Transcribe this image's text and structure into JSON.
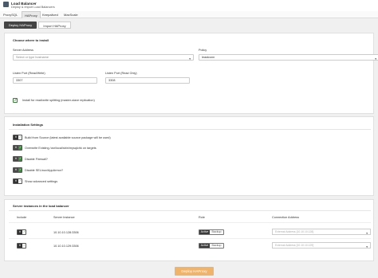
{
  "header": {
    "title": "Load Balancer",
    "subtitle": "Deploy & Import Load Balancers"
  },
  "tabs": [
    "ProxySQL",
    "HAProxy",
    "Keepalived",
    "MaxScale"
  ],
  "active_tab": "HAProxy",
  "subtabs": {
    "deploy": "Deploy HAProxy",
    "import": "Import HAProxy"
  },
  "install": {
    "section_title": "Choose where to install",
    "server_address_label": "Server Address",
    "server_address_placeholder": "Select or type hostname",
    "policy_label": "Policy",
    "policy_value": "leastconn",
    "listen_rw_label": "Listen Port (Read/Write)",
    "listen_rw_value": "3307",
    "listen_ro_label": "Listen Port (Read Only)",
    "listen_ro_value": "3308",
    "rw_split_label": "Install for read/write splitting (master-slave replication)"
  },
  "settings": {
    "section_title": "Installation Settings",
    "options": [
      {
        "label": "Build from Source (latest available source package will be used)",
        "state": "off"
      },
      {
        "label": "Overwrite Existing /usr/local/sbin/mysqlchk on targets",
        "state": "on"
      },
      {
        "label": "Disable Firewall?",
        "state": "on"
      },
      {
        "label": "Disable SELinux/AppArmor?",
        "state": "on"
      },
      {
        "label": "Show advanced settings",
        "state": "off"
      }
    ]
  },
  "instances": {
    "section_title": "Server instances in the load balancer",
    "columns": {
      "include": "Include",
      "server": "Server Instance",
      "role": "Role",
      "conn": "Connection Address"
    },
    "rows": [
      {
        "server": "10.10.10.128:3306",
        "role_active": "Active",
        "role_backup": "Backup",
        "conn": "External Address [10.10.10.128]"
      },
      {
        "server": "10.10.10.129:3306",
        "role_active": "Active",
        "role_backup": "Backup",
        "conn": "External Address [10.10.10.129]"
      }
    ]
  },
  "deploy_button": "Deploy HAProxy",
  "colors": {
    "accent": "#f0b36a",
    "check_green": "#3b8a3b",
    "dark": "#444444"
  }
}
